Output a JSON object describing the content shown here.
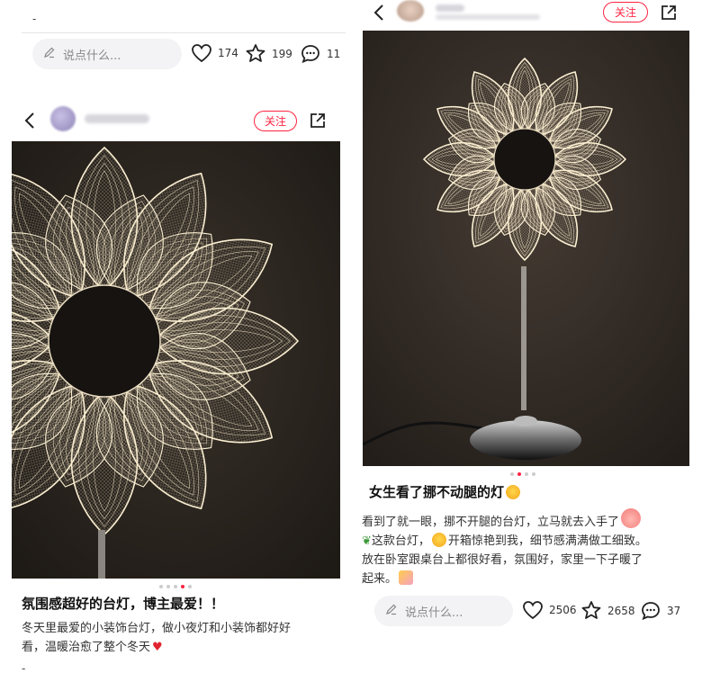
{
  "top_left": {
    "dash": "-",
    "comment_placeholder": "说点什么...",
    "likes": "174",
    "stars": "199",
    "comments": "11"
  },
  "left_post": {
    "follow_label": "关注",
    "title": "氛围感超好的台灯，博主最爱！！",
    "body_line1": "冬天里最爱的小装饰台灯，做小夜灯和小装饰都好好",
    "body_line2": "看，温暖治愈了整个冬天",
    "footer_dash": "-"
  },
  "right_post": {
    "follow_label": "关注",
    "title": "女生看了挪不动腿的灯",
    "body_line1": "看到了就一眼，挪不开腿的台灯，立马就去入手了",
    "body_line2a": "这款台灯，",
    "body_line2b": "开箱惊艳到我，细节感满满做工细致。",
    "body_line3": "放在卧室跟桌台上都很好看，氛围好，家里一下子暖了",
    "body_line4": "起来。",
    "comment_placeholder": "说点什么...",
    "likes": "2506",
    "stars": "2658",
    "comments": "37"
  },
  "colors": {
    "accent": "#ff2442",
    "photo_bg": "#2b2520",
    "lamp_glow": "#fff3d6"
  },
  "icons": [
    "back-icon",
    "share-icon",
    "pencil-icon",
    "heart-icon",
    "star-icon",
    "comment-icon"
  ]
}
